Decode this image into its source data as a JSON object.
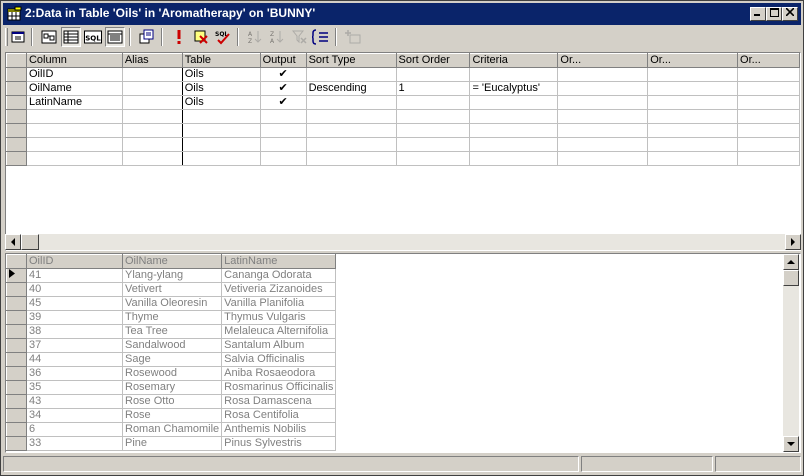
{
  "window": {
    "title": "2:Data in Table 'Oils' in 'Aromatherapy' on 'BUNNY'"
  },
  "toolbar": {
    "buttons": [
      {
        "name": "properties",
        "icon": "properties-icon"
      },
      {
        "name": "show-diagram-pane",
        "icon": "diagram-pane-icon"
      },
      {
        "name": "show-grid-pane",
        "icon": "grid-pane-icon",
        "pressed": true
      },
      {
        "name": "show-sql-pane",
        "icon": "sql-pane-icon",
        "label": "SQL"
      },
      {
        "name": "show-results-pane",
        "icon": "results-pane-icon",
        "pressed": true
      },
      {
        "name": "change-query-type",
        "icon": "query-type-icon"
      },
      {
        "name": "run",
        "icon": "exclamation-icon",
        "label": "!"
      },
      {
        "name": "cancel-query",
        "icon": "cancel-query-icon"
      },
      {
        "name": "verify-sql",
        "icon": "verify-sql-icon",
        "label": "SQL"
      },
      {
        "name": "sort-ascending",
        "icon": "sort-ascending-icon",
        "disabled": true
      },
      {
        "name": "sort-descending",
        "icon": "sort-descending-icon",
        "disabled": true
      },
      {
        "name": "remove-filter",
        "icon": "remove-filter-icon",
        "disabled": true
      },
      {
        "name": "group-by",
        "icon": "group-by-icon"
      },
      {
        "name": "add-table",
        "icon": "add-table-icon",
        "disabled": true
      }
    ]
  },
  "query_grid": {
    "columns": [
      "Column",
      "Alias",
      "Table",
      "Output",
      "Sort Type",
      "Sort Order",
      "Criteria",
      "Or...",
      "Or...",
      "Or..."
    ],
    "rows": [
      {
        "column": "OilID",
        "alias": "",
        "table": "Oils",
        "output": "✔",
        "sort_type": "",
        "sort_order": "",
        "criteria": "",
        "or1": "",
        "or2": "",
        "or3": ""
      },
      {
        "column": "OilName",
        "alias": "",
        "table": "Oils",
        "output": "✔",
        "sort_type": "Descending",
        "sort_order": "1",
        "criteria": "= 'Eucalyptus'",
        "or1": "",
        "or2": "",
        "or3": ""
      },
      {
        "column": "LatinName",
        "alias": "",
        "table": "Oils",
        "output": "✔",
        "sort_type": "",
        "sort_order": "",
        "criteria": "",
        "or1": "",
        "or2": "",
        "or3": ""
      }
    ]
  },
  "results_grid": {
    "columns": [
      "OilID",
      "OilName",
      "LatinName"
    ],
    "rows": [
      {
        "OilID": "41",
        "OilName": "Ylang-ylang",
        "LatinName": "Cananga Odorata"
      },
      {
        "OilID": "40",
        "OilName": "Vetivert",
        "LatinName": "Vetiveria Zizanoides"
      },
      {
        "OilID": "45",
        "OilName": "Vanilla Oleoresin",
        "LatinName": "Vanilla Planifolia"
      },
      {
        "OilID": "39",
        "OilName": "Thyme",
        "LatinName": "Thymus Vulgaris"
      },
      {
        "OilID": "38",
        "OilName": "Tea Tree",
        "LatinName": "Melaleuca Alternifolia"
      },
      {
        "OilID": "37",
        "OilName": "Sandalwood",
        "LatinName": "Santalum Album"
      },
      {
        "OilID": "44",
        "OilName": "Sage",
        "LatinName": "Salvia Officinalis"
      },
      {
        "OilID": "36",
        "OilName": "Rosewood",
        "LatinName": "Aniba Rosaeodora"
      },
      {
        "OilID": "35",
        "OilName": "Rosemary",
        "LatinName": "Rosmarinus Officinalis"
      },
      {
        "OilID": "43",
        "OilName": "Rose Otto",
        "LatinName": "Rosa Damascena"
      },
      {
        "OilID": "34",
        "OilName": "Rose",
        "LatinName": "Rosa Centifolia"
      },
      {
        "OilID": "6",
        "OilName": "Roman Chamomile",
        "LatinName": "Anthemis Nobilis"
      },
      {
        "OilID": "33",
        "OilName": "Pine",
        "LatinName": "Pinus Sylvestris"
      }
    ]
  },
  "colors": {
    "titlebar": "#0a246a",
    "face": "#d4d0c8",
    "grid_line": "#c0c0c0",
    "dim_text": "#808080"
  }
}
